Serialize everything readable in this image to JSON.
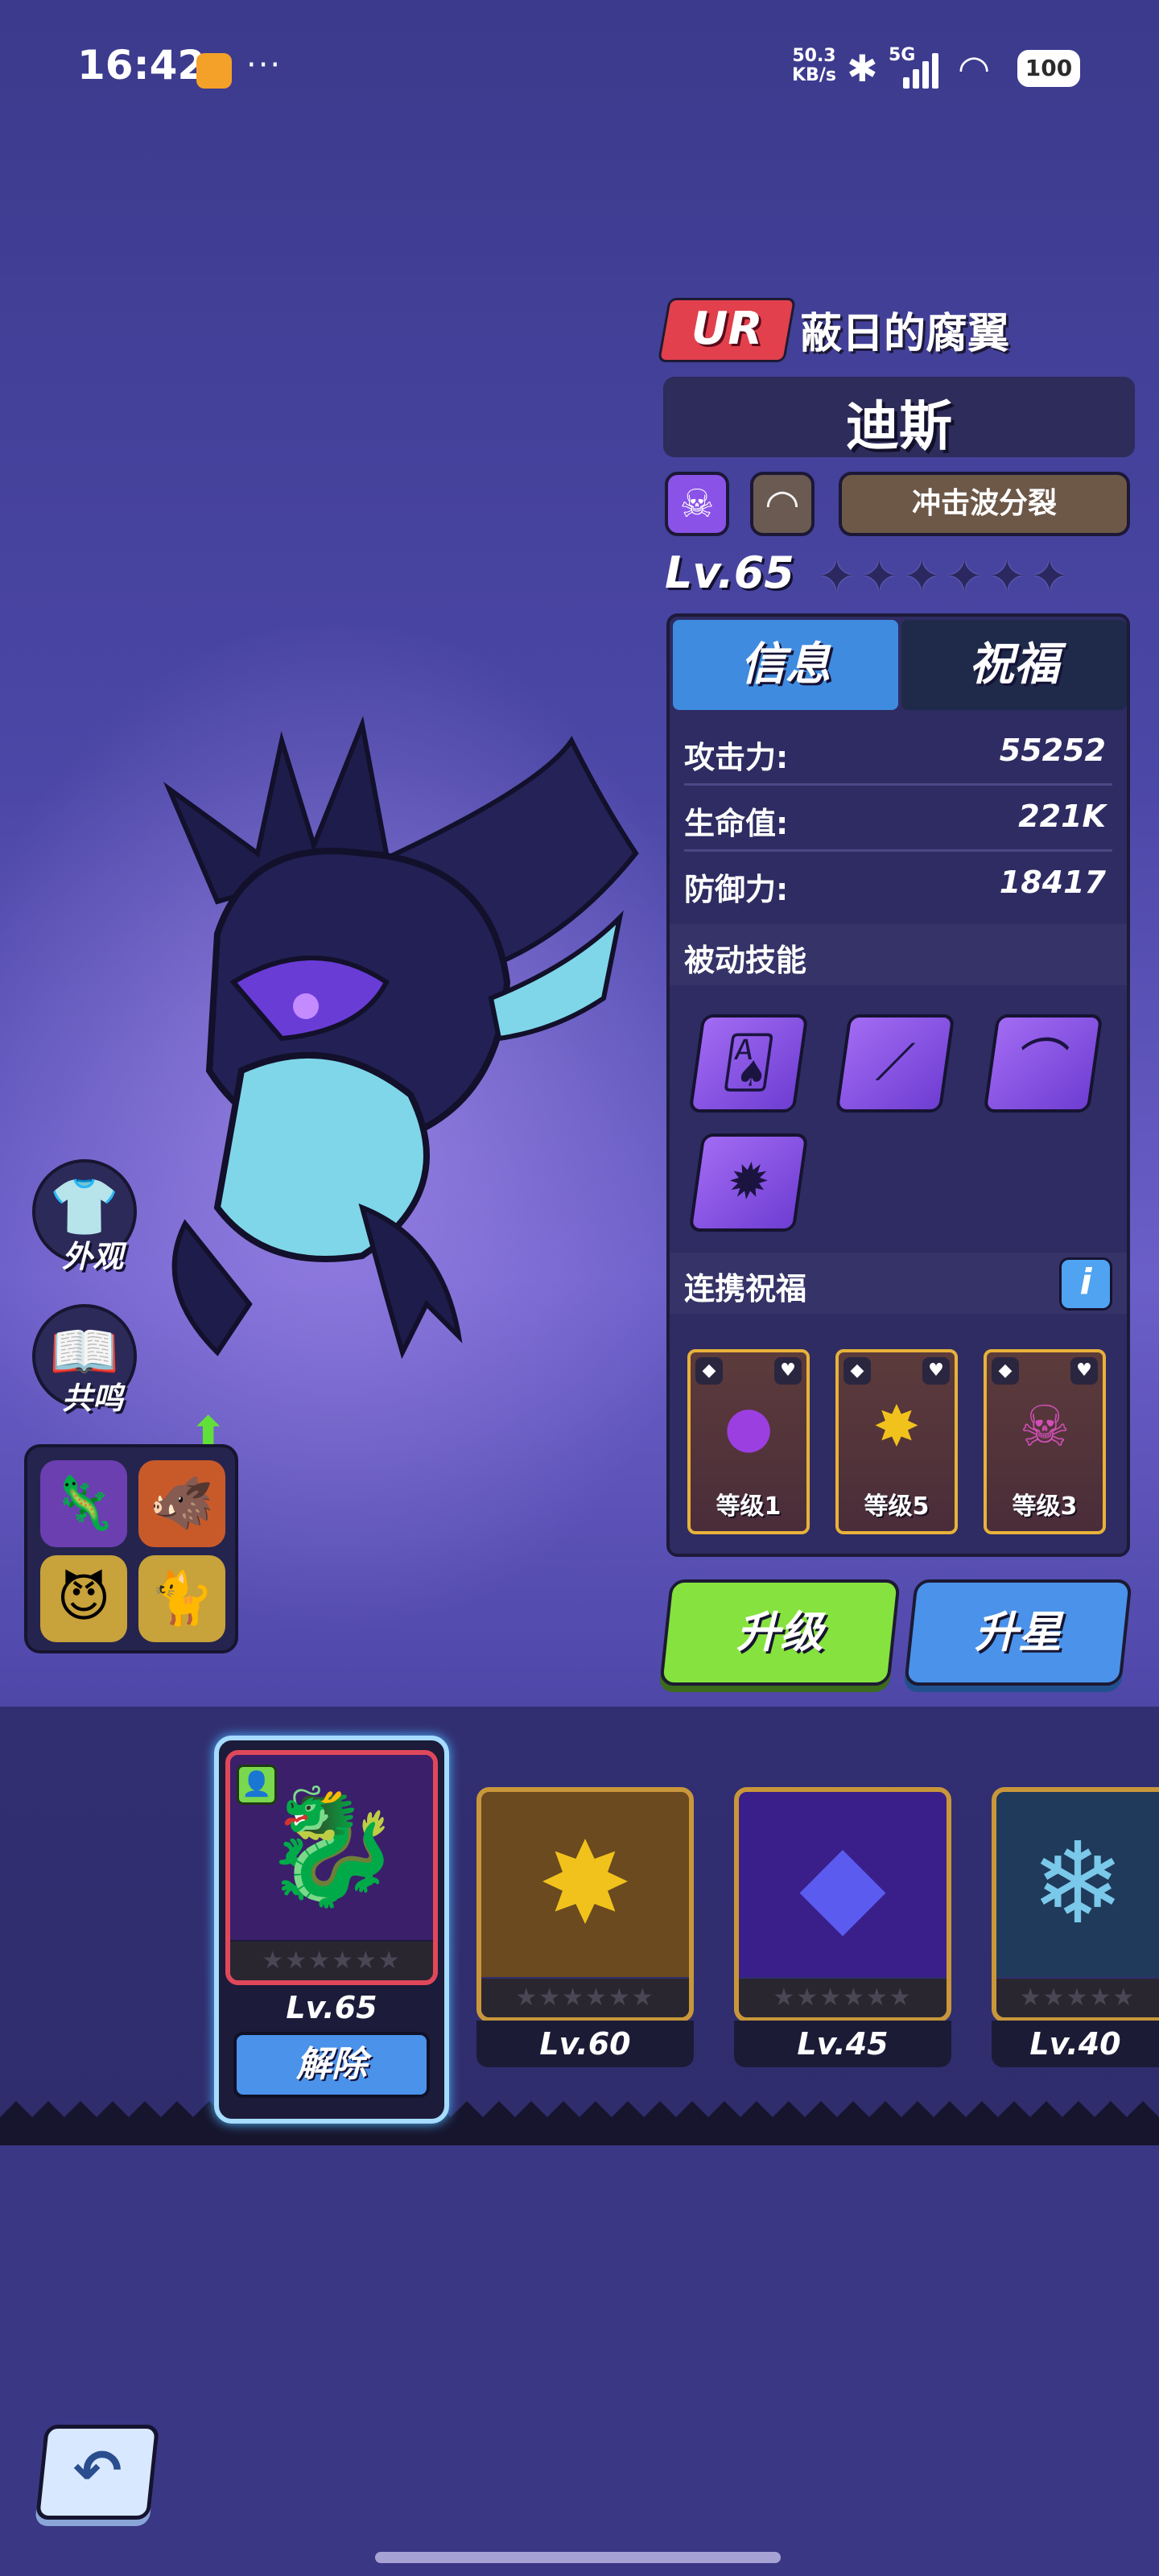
{
  "status_bar": {
    "time": "16:42",
    "speed_value": "50.3",
    "speed_unit": "KB/s",
    "network": "5G",
    "battery": "100"
  },
  "hero": {
    "rarity": "UR",
    "subtitle": "蔽日的腐翼",
    "name": "迪斯",
    "element_icon": "skull-icon",
    "type_icon": "horn-icon",
    "skill_tag": "冲击波分裂",
    "level": "Lv.65",
    "stars": "✦✦✦✦✦✦"
  },
  "panel": {
    "tabs": [
      {
        "label": "信息"
      },
      {
        "label": "祝福"
      }
    ],
    "stats": [
      {
        "label": "攻击力:",
        "value": "55252"
      },
      {
        "label": "生命值:",
        "value": "221K"
      },
      {
        "label": "防御力:",
        "value": "18417"
      }
    ],
    "passive_header": "被动技能",
    "passive_skills": [
      {
        "icon": "cards-skull-icon",
        "glyph": "🂡"
      },
      {
        "icon": "claw-icon",
        "glyph": "⟋"
      },
      {
        "icon": "wing-icon",
        "glyph": "⌒"
      },
      {
        "icon": "burst-icon",
        "glyph": "✹"
      }
    ],
    "link_header": "连携祝福",
    "info_button": "i",
    "blessings": [
      {
        "level": "等级1",
        "icon": "purple-slime-icon",
        "glyph": "●",
        "color": "#9b3fe0"
      },
      {
        "level": "等级5",
        "icon": "yellow-spark-icon",
        "glyph": "✸",
        "color": "#f2c21c"
      },
      {
        "level": "等级3",
        "icon": "pink-ghost-icon",
        "glyph": "☠",
        "color": "#d14fb6"
      }
    ]
  },
  "buttons": {
    "upgrade": "升级",
    "star_up": "升星",
    "remove": "解除"
  },
  "side": {
    "appearance_label": "外观",
    "resonance_label": "共鸣"
  },
  "hero_bar": [
    {
      "level": "Lv.65",
      "selected": true
    },
    {
      "level": "Lv.60",
      "selected": false
    },
    {
      "level": "Lv.45",
      "selected": false
    },
    {
      "level": "Lv.40",
      "selected": false
    }
  ],
  "colors": {
    "accent_blue": "#4a92ea",
    "accent_green": "#86e23e",
    "rarity_red": "#e2404c",
    "gold_frame": "#c9973a"
  }
}
